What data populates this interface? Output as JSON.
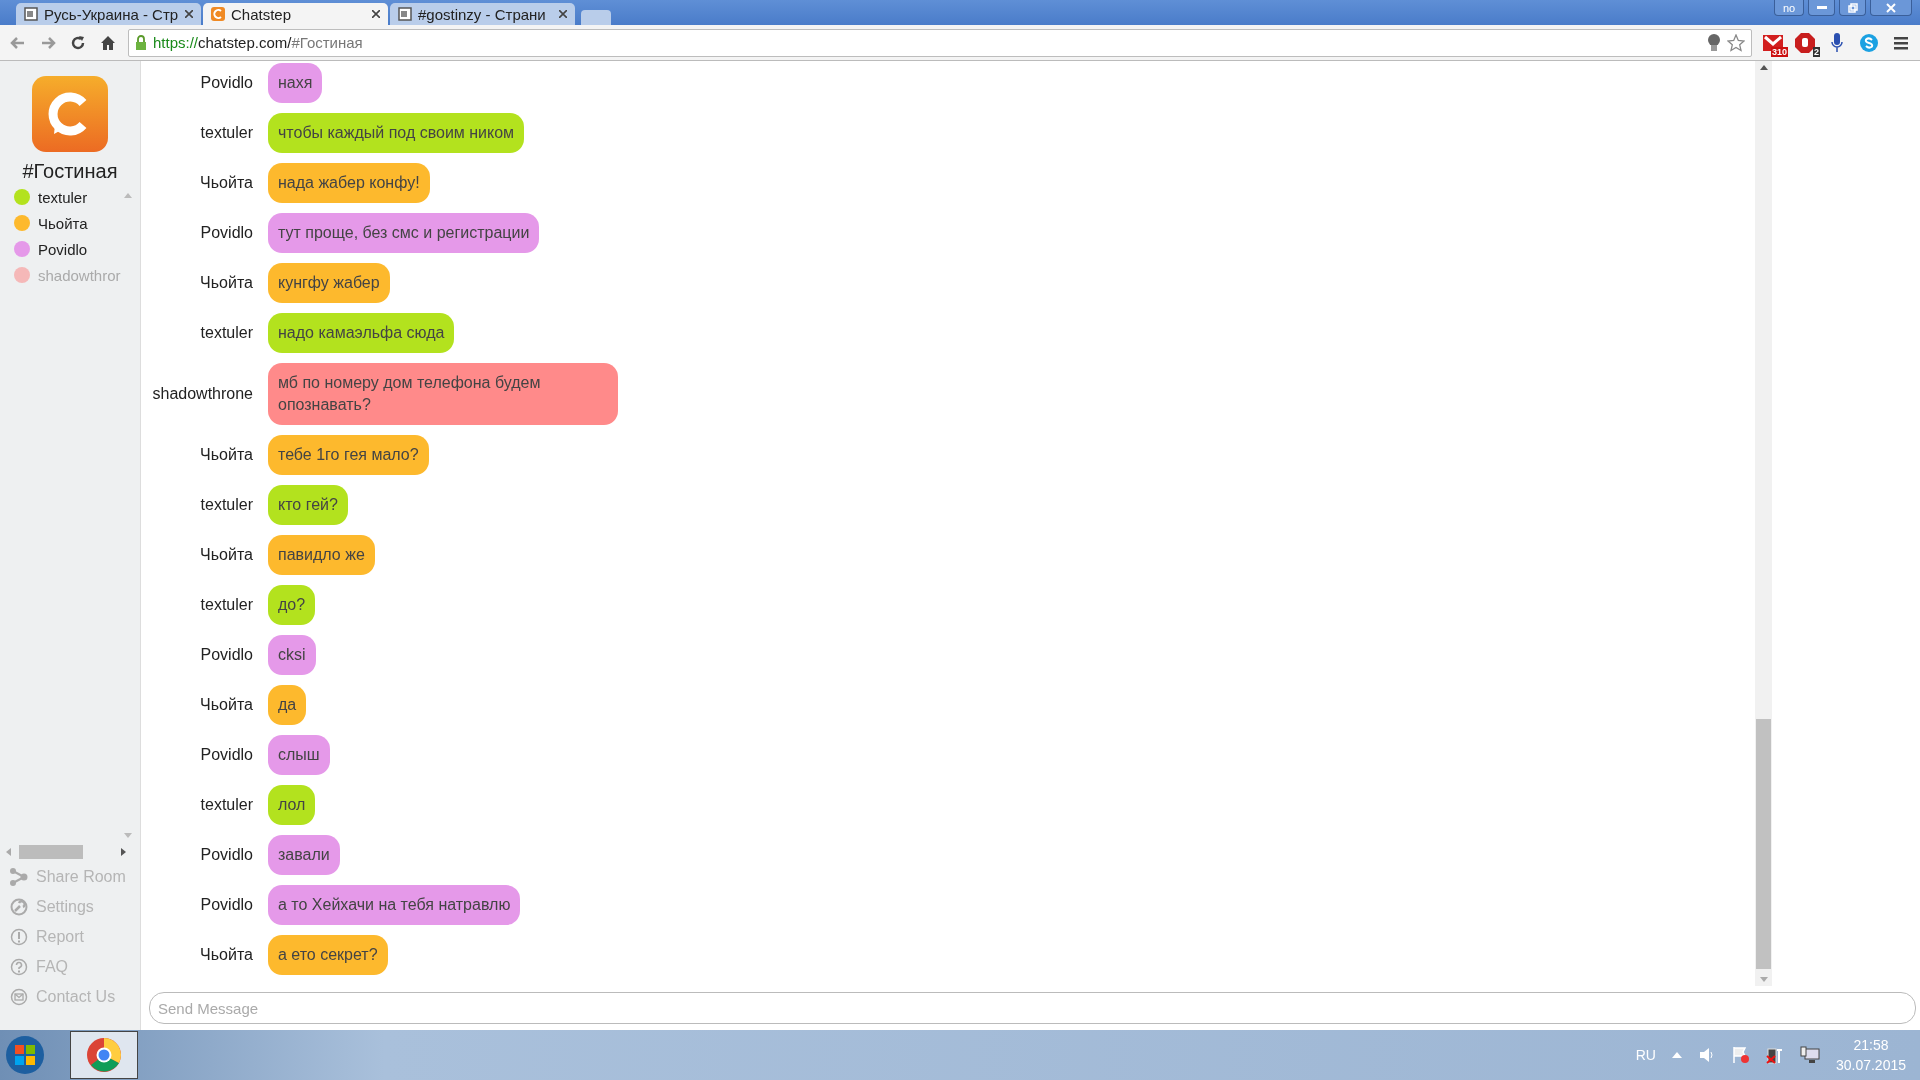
{
  "browser": {
    "tabs": [
      {
        "title": "Русь-Украина - Стр",
        "selected": false,
        "kind": "page"
      },
      {
        "title": "Chatstep",
        "selected": true,
        "kind": "chatstep"
      },
      {
        "title": "#gostinzy - Страни",
        "selected": false,
        "kind": "page"
      }
    ],
    "profile": "no",
    "url_scheme": "https://",
    "url_host": "chatstep.com/",
    "url_path": "#Гостиная",
    "mail_count": "310",
    "block_count": "2"
  },
  "sidebar": {
    "room": "#Гостиная",
    "users": [
      {
        "name": "textuler",
        "color": "#b3e21e",
        "away": false
      },
      {
        "name": "Чьойта",
        "color": "#fdb92d",
        "away": false
      },
      {
        "name": "Povidlo",
        "color": "#e599e9",
        "away": false
      },
      {
        "name": "shadowthror",
        "color": "#f5b8b8",
        "away": true
      }
    ],
    "links": [
      {
        "label": "Share Room",
        "kind": "share"
      },
      {
        "label": "Settings",
        "kind": "settings"
      },
      {
        "label": "Report",
        "kind": "report"
      },
      {
        "label": "FAQ",
        "kind": "faq"
      },
      {
        "label": "Contact Us",
        "kind": "contact"
      }
    ]
  },
  "messages": [
    {
      "user": "Povidlo",
      "text": "нахя",
      "color": "#e599e9"
    },
    {
      "user": "textuler",
      "text": "чтобы каждый под своим ником",
      "color": "#b3e21e"
    },
    {
      "user": "Чьойта",
      "text": "нада жабер конфу!",
      "color": "#fdb92d"
    },
    {
      "user": "Povidlo",
      "text": "тут проще, без смс и регистрации",
      "color": "#e599e9"
    },
    {
      "user": "Чьойта",
      "text": "кунгфу жабер",
      "color": "#fdb92d"
    },
    {
      "user": "textuler",
      "text": "надо камаэльфа сюда",
      "color": "#b3e21e"
    },
    {
      "user": "shadowthrone",
      "text": "мб по номеру дом телефона будем опознавать?",
      "color": "#ff8a8a"
    },
    {
      "user": "Чьойта",
      "text": "тебе 1го гея мало?",
      "color": "#fdb92d"
    },
    {
      "user": "textuler",
      "text": "кто гей?",
      "color": "#b3e21e"
    },
    {
      "user": "Чьойта",
      "text": "павидло же",
      "color": "#fdb92d"
    },
    {
      "user": "textuler",
      "text": "до?",
      "color": "#b3e21e"
    },
    {
      "user": "Povidlo",
      "text": "cksi",
      "color": "#e599e9"
    },
    {
      "user": "Чьойта",
      "text": "да",
      "color": "#fdb92d"
    },
    {
      "user": "Povidlo",
      "text": "слыш",
      "color": "#e599e9"
    },
    {
      "user": "textuler",
      "text": "лол",
      "color": "#b3e21e"
    },
    {
      "user": "Povidlo",
      "text": "завали",
      "color": "#e599e9"
    },
    {
      "user": "Povidlo",
      "text": "а то Хейхачи на тебя натравлю",
      "color": "#e599e9"
    },
    {
      "user": "Чьойта",
      "text": "а ето секрет?",
      "color": "#fdb92d"
    }
  ],
  "composer": {
    "placeholder": "Send Message"
  },
  "taskbar": {
    "language": "RU",
    "time": "21:58",
    "date": "30.07.2015"
  }
}
